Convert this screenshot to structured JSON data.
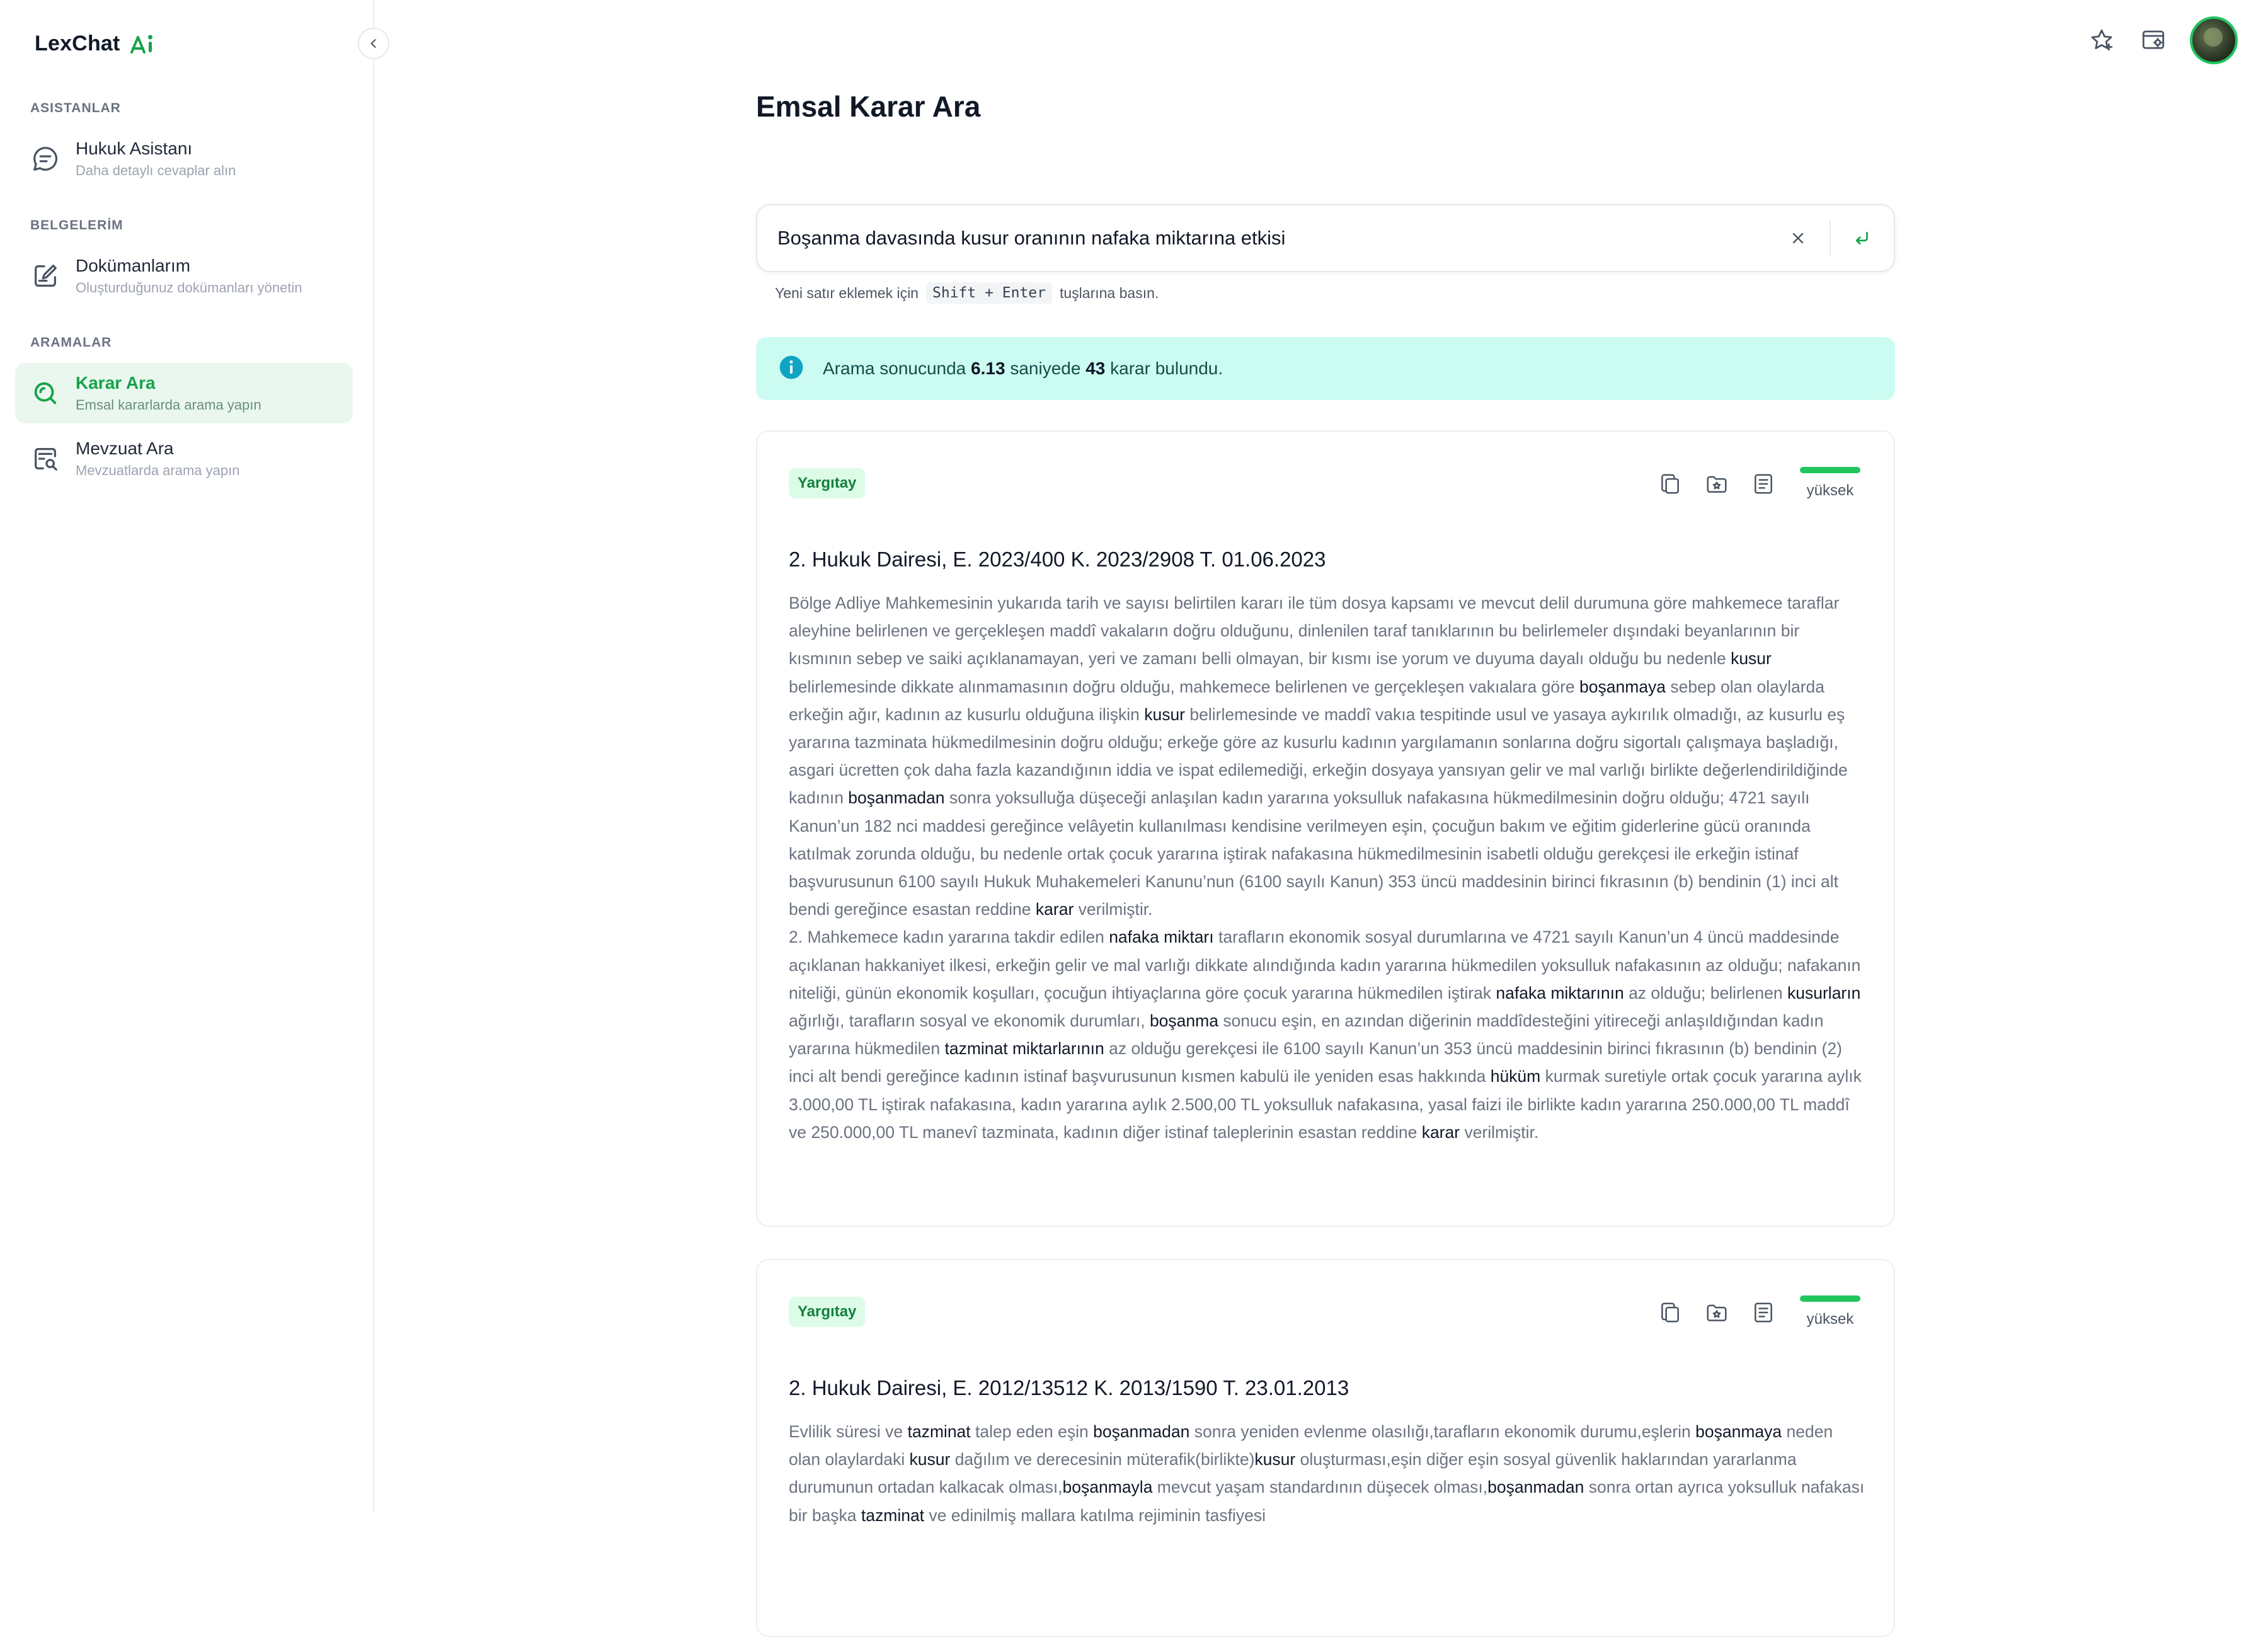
{
  "app": {
    "name": "LexChat",
    "logo_mark": "Ai"
  },
  "sidebar": {
    "sections": [
      {
        "label": "ASISTANLAR",
        "items": [
          {
            "title": "Hukuk Asistanı",
            "subtitle": "Daha detaylı cevaplar alın",
            "icon": "chat-bubble-icon"
          }
        ]
      },
      {
        "label": "BELGELERİM",
        "items": [
          {
            "title": "Dokümanlarım",
            "subtitle": "Oluşturduğunuz dokümanları yönetin",
            "icon": "edit-document-icon"
          }
        ]
      },
      {
        "label": "ARAMALAR",
        "items": [
          {
            "title": "Karar Ara",
            "subtitle": "Emsal kararlarda arama yapın",
            "icon": "search-icon",
            "active": true
          },
          {
            "title": "Mevzuat Ara",
            "subtitle": "Mevzuatlarda arama yapın",
            "icon": "document-search-icon"
          }
        ]
      }
    ]
  },
  "page": {
    "title": "Emsal Karar Ara"
  },
  "search": {
    "value": "Boşanma davasında kusur oranının nafaka miktarına etkisi",
    "hint_before": "Yeni satır eklemek için",
    "hint_kbd": "Shift + Enter",
    "hint_after": "tuşlarına basın."
  },
  "result_info": {
    "prefix": "Arama sonucunda",
    "seconds": "6.13",
    "mid": "saniyede",
    "count": "43",
    "suffix": "karar bulundu."
  },
  "results": [
    {
      "court": "Yargıtay",
      "relevance": "yüksek",
      "title": "2. Hukuk Dairesi, E. 2023/400 K. 2023/2908 T. 01.06.2023",
      "body_segments": [
        {
          "t": "Bölge Adliye Mahkemesinin yukarıda tarih ve sayısı belirtilen kararı ile tüm dosya kapsamı ve mevcut delil durumuna göre mahkemece taraflar aleyhine belirlenen ve gerçekleşen maddî vakaların doğru olduğunu, dinlenilen taraf tanıklarının bu belirlemeler dışındaki beyanlarının bir kısmının sebep ve saiki açıklanamayan, yeri ve zamanı belli olmayan, bir kısmı ise yorum ve duyuma dayalı olduğu bu nedenle "
        },
        {
          "t": "kusur",
          "h": true
        },
        {
          "t": " belirlemesinde dikkate alınmamasının doğru olduğu, mahkemece belirlenen ve gerçekleşen vakıalara göre "
        },
        {
          "t": "boşanmaya",
          "h": true
        },
        {
          "t": " sebep olan olaylarda erkeğin ağır, kadının az kusurlu olduğuna ilişkin "
        },
        {
          "t": "kusur",
          "h": true
        },
        {
          "t": " belirlemesinde ve maddî vakıa tespitinde usul ve yasaya aykırılık olmadığı, az kusurlu eş yararına tazminata hükmedilmesinin doğru olduğu; erkeğe göre az kusurlu kadının yargılamanın sonlarına doğru sigortalı çalışmaya başladığı, asgari ücretten çok daha fazla kazandığının iddia ve ispat edilemediği, erkeğin dosyaya yansıyan gelir ve mal varlığı birlikte değerlendirildiğinde kadının "
        },
        {
          "t": "boşanmadan",
          "h": true
        },
        {
          "t": " sonra yoksulluğa düşeceği anlaşılan kadın yararına yoksulluk nafakasına hükmedilmesinin doğru olduğu; 4721 sayılı Kanun’un 182 nci maddesi gereğince velâyetin kullanılması kendisine verilmeyen eşin, çocuğun bakım ve eğitim giderlerine gücü oranında katılmak zorunda olduğu, bu nedenle ortak çocuk yararına iştirak nafakasına hükmedilmesinin isabetli olduğu gerekçesi ile erkeğin istinaf başvurusunun 6100 sayılı Hukuk Muhakemeleri Kanunu’nun (6100 sayılı Kanun) 353 üncü maddesinin birinci fıkrasının (b) bendinin (1) inci alt bendi gereğince esastan reddine "
        },
        {
          "t": "karar",
          "h": true
        },
        {
          "t": " verilmiştir."
        },
        {
          "br": true
        },
        {
          "t": "2. Mahkemece kadın yararına takdir edilen "
        },
        {
          "t": "nafaka miktarı",
          "h": true
        },
        {
          "t": " tarafların ekonomik sosyal durumlarına ve 4721 sayılı Kanun’un 4 üncü maddesinde açıklanan hakkaniyet ilkesi, erkeğin gelir ve mal varlığı dikkate alındığında kadın yararına hükmedilen yoksulluk nafakasının az olduğu; nafakanın niteliği, günün ekonomik koşulları, çocuğun ihtiyaçlarına göre çocuk yararına hükmedilen iştirak "
        },
        {
          "t": "nafaka miktarının",
          "h": true
        },
        {
          "t": " az olduğu; belirlenen "
        },
        {
          "t": "kusurların",
          "h": true
        },
        {
          "t": " ağırlığı, tarafların sosyal ve ekonomik durumları, "
        },
        {
          "t": "boşanma",
          "h": true
        },
        {
          "t": " sonucu eşin, en azından diğerinin maddîdesteğini yitireceği anlaşıldığından kadın yararına hükmedilen "
        },
        {
          "t": "tazminat miktarlarının",
          "h": true
        },
        {
          "t": " az olduğu gerekçesi ile 6100 sayılı Kanun’un 353 üncü maddesinin birinci fıkrasının (b) bendinin (2) inci alt bendi gereğince kadının istinaf başvurusunun kısmen kabulü ile yeniden esas hakkında "
        },
        {
          "t": "hüküm",
          "h": true
        },
        {
          "t": " kurmak suretiyle ortak çocuk yararına aylık 3.000,00 TL iştirak nafakasına, kadın yararına aylık 2.500,00 TL yoksulluk nafakasına, yasal faizi ile birlikte kadın yararına 250.000,00 TL maddî ve 250.000,00 TL manevî tazminata, kadının diğer istinaf taleplerinin esastan reddine "
        },
        {
          "t": "karar",
          "h": true
        },
        {
          "t": " verilmiştir."
        }
      ]
    },
    {
      "court": "Yargıtay",
      "relevance": "yüksek",
      "title": "2. Hukuk Dairesi, E. 2012/13512 K. 2013/1590 T. 23.01.2013",
      "body_segments": [
        {
          "t": "Evlilik süresi ve "
        },
        {
          "t": "tazminat",
          "h": true
        },
        {
          "t": " talep eden eşin "
        },
        {
          "t": "boşanmadan",
          "h": true
        },
        {
          "t": " sonra yeniden evlenme olasılığı,tarafların ekonomik durumu,eşlerin "
        },
        {
          "t": "boşanmaya",
          "h": true
        },
        {
          "t": " neden olan olaylardaki "
        },
        {
          "t": "kusur",
          "h": true
        },
        {
          "t": " dağılım ve derecesinin müterafik(birlikte)"
        },
        {
          "t": "kusur",
          "h": true
        },
        {
          "t": " oluşturması,eşin diğer eşin sosyal güvenlik haklarından yararlanma durumunun ortadan kalkacak olması,"
        },
        {
          "t": "boşanmayla",
          "h": true
        },
        {
          "t": " mevcut yaşam standardının düşecek olması,"
        },
        {
          "t": "boşanmadan",
          "h": true
        },
        {
          "t": " sonra ortan ayrıca yoksulluk nafakası bir başka "
        },
        {
          "t": "tazminat",
          "h": true
        },
        {
          "t": " ve edinilmiş mallara katılma rejiminin tasfiyesi"
        }
      ]
    }
  ],
  "colors": {
    "accent": "#16a34a",
    "info_bg": "#ccfbf1",
    "badge_bg": "#dcfce7"
  }
}
